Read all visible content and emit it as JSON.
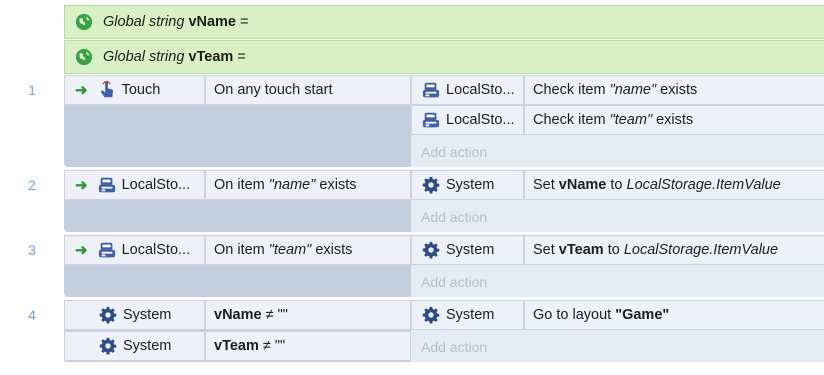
{
  "globals": [
    {
      "prefix": "Global string",
      "name": "vName",
      "suffix": "="
    },
    {
      "prefix": "Global string",
      "name": "vTeam",
      "suffix": "="
    }
  ],
  "events": [
    {
      "number": "1",
      "conditions": [
        {
          "object": "Touch",
          "text": "On any touch start"
        }
      ],
      "actions": [
        {
          "object": "LocalSto...",
          "pre": "Check item ",
          "quoted": "\"name\"",
          "post": " exists"
        },
        {
          "object": "LocalSto...",
          "pre": "Check item ",
          "quoted": "\"team\"",
          "post": " exists"
        }
      ],
      "add_action": "Add action"
    },
    {
      "number": "2",
      "conditions": [
        {
          "object": "LocalSto...",
          "pre": "On item ",
          "quoted": "\"name\"",
          "post": " exists"
        }
      ],
      "actions": [
        {
          "object": "System",
          "pre": "Set ",
          "bold": "vName",
          "mid": " to ",
          "italic": "LocalStorage.ItemValue"
        }
      ],
      "add_action": "Add action"
    },
    {
      "number": "3",
      "conditions": [
        {
          "object": "LocalSto...",
          "pre": "On item ",
          "quoted": "\"team\"",
          "post": " exists"
        }
      ],
      "actions": [
        {
          "object": "System",
          "pre": "Set ",
          "bold": "vTeam",
          "mid": " to ",
          "italic": "LocalStorage.ItemValue"
        }
      ],
      "add_action": "Add action"
    },
    {
      "number": "4",
      "conditions": [
        {
          "object": "System",
          "bold": "vName",
          "post": " ≠ \"\""
        },
        {
          "object": "System",
          "bold": "vTeam",
          "post": " ≠ \"\""
        }
      ],
      "actions": [
        {
          "object": "System",
          "pre": "Go to layout ",
          "bold": "\"Game\""
        }
      ],
      "add_action": "Add action"
    }
  ],
  "colors": {
    "global_bg": "#d9f0c4",
    "event_bg": "#c3cede",
    "cell_bg": "#eef2f8",
    "trigger_arrow": "#2f9a2f",
    "row_number": "#7a9cc4"
  }
}
